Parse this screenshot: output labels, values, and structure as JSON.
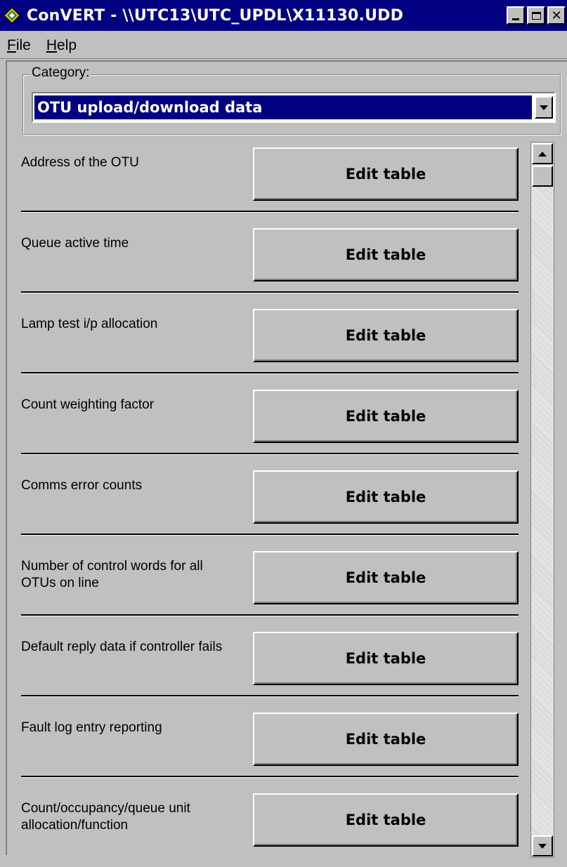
{
  "window": {
    "title": "ConVERT - \\\\UTC13\\UTC_UPDL\\X11130.UDD",
    "icon": "diamond-road-sign-icon",
    "controls": [
      "minimize-icon",
      "maximize-icon",
      "close-icon"
    ],
    "close_glyph": "✕"
  },
  "menu": {
    "items": [
      {
        "label": "File",
        "mnemonic": "F",
        "rest": "ile"
      },
      {
        "label": "Help",
        "mnemonic": "H",
        "rest": "elp"
      }
    ]
  },
  "category": {
    "label": "Category:",
    "selected": "OTU upload/download data"
  },
  "rows": [
    {
      "label": "Address of the OTU",
      "button": "Edit table"
    },
    {
      "label": "Queue active time",
      "button": "Edit table"
    },
    {
      "label": "Lamp test i/p allocation",
      "button": "Edit table"
    },
    {
      "label": "Count weighting factor",
      "button": "Edit table"
    },
    {
      "label": "Comms error counts",
      "button": "Edit table"
    },
    {
      "label": "Number of control words for all OTUs on line",
      "button": "Edit table"
    },
    {
      "label": "Default reply data if controller fails",
      "button": "Edit table"
    },
    {
      "label": "Fault log entry reporting",
      "button": "Edit table"
    },
    {
      "label": "Count/occupancy/queue unit allocation/function",
      "button": "Edit table"
    }
  ],
  "colors": {
    "titlebar": "#000080",
    "face": "#c0c0c0",
    "selection": "#000080"
  }
}
